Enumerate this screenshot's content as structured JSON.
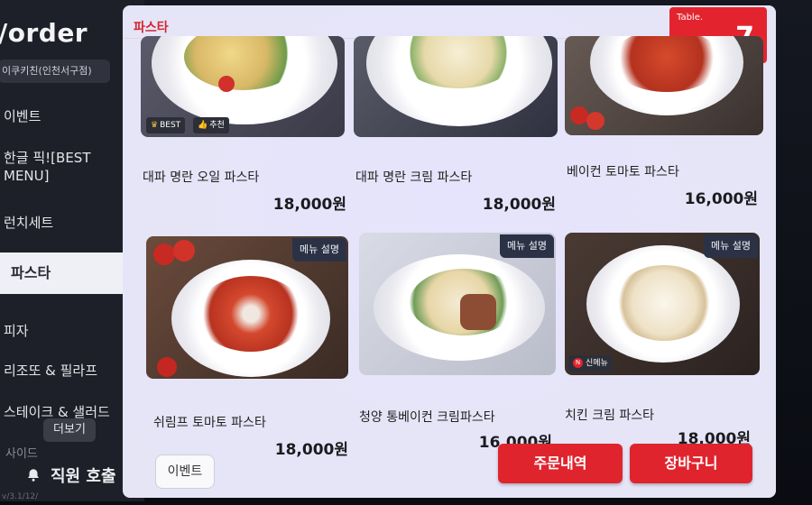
{
  "app": {
    "logo": "/order",
    "store": "이쿠키친(인천서구점)"
  },
  "sidebar": {
    "items": [
      {
        "label": "이벤트"
      },
      {
        "label": "한글 픽![BEST MENU]"
      },
      {
        "label": "런치세트"
      },
      {
        "label": "파스타",
        "active": true
      },
      {
        "label": "피자"
      },
      {
        "label": "리조또 & 필라프"
      },
      {
        "label": "스테이크 & 샐러드"
      },
      {
        "label": "사이드"
      }
    ],
    "more_label": "더보기",
    "call_staff": "직원 호출",
    "version": "v/3.1/12/"
  },
  "category": {
    "title": "파스타"
  },
  "table": {
    "label": "Table.",
    "number": "7"
  },
  "menu": [
    {
      "name": "대파 명란 오일 파스타",
      "price": "18,000원",
      "tags": [
        "BEST",
        "추천"
      ]
    },
    {
      "name": "대파 명란 크림 파스타",
      "price": "18,000원"
    },
    {
      "name": "베이컨 토마토 파스타",
      "price": "16,000원"
    },
    {
      "name": "쉬림프 토마토 파스타",
      "price": "18,000원",
      "desc": "메뉴 설명"
    },
    {
      "name": "청양 통베이컨 크림파스타",
      "price": "16,000원",
      "desc": "메뉴 설명"
    },
    {
      "name": "치킨 크림 파스타",
      "price": "18,000원",
      "desc": "메뉴 설명",
      "tags": [
        "신메뉴"
      ]
    }
  ],
  "footer": {
    "event_label": "이벤트",
    "order_history_label": "주문내역",
    "cart_label": "장바구니"
  },
  "colors": {
    "accent": "#e0242e",
    "sidebar": "#1d2028",
    "panel": "#f4f3fb"
  }
}
